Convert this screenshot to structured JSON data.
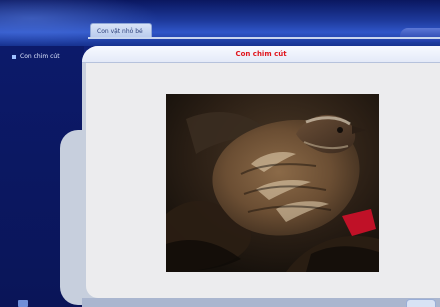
{
  "tabs": [
    {
      "label": "Con vật nhỏ bé"
    }
  ],
  "sidebar": {
    "items": [
      {
        "label": "Con chim cút"
      }
    ]
  },
  "main": {
    "title": "Con chim cút",
    "image_alt": "Hình ảnh con chim cút"
  },
  "colors": {
    "title_red": "#e0161d",
    "frame_blue": "#0f1f6e",
    "panel_bg": "#ececee"
  }
}
